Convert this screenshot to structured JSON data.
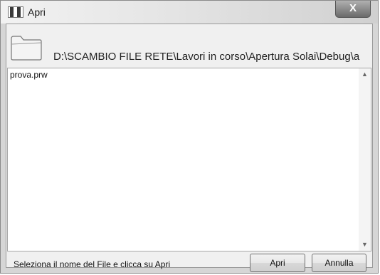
{
  "window": {
    "title": "Apri",
    "close_glyph": "X"
  },
  "path": {
    "icon": "folder-icon",
    "text": "D:\\SCAMBIO FILE RETE\\Lavori in corso\\Apertura Solai\\Debug\\a"
  },
  "files": [
    {
      "name": "prova.prw"
    }
  ],
  "scrollbar": {
    "up_glyph": "▲",
    "down_glyph": "▼"
  },
  "footer": {
    "status": "Seleziona il nome del File e clicca su Apri",
    "open_label": "Apri",
    "cancel_label": "Annulla"
  }
}
